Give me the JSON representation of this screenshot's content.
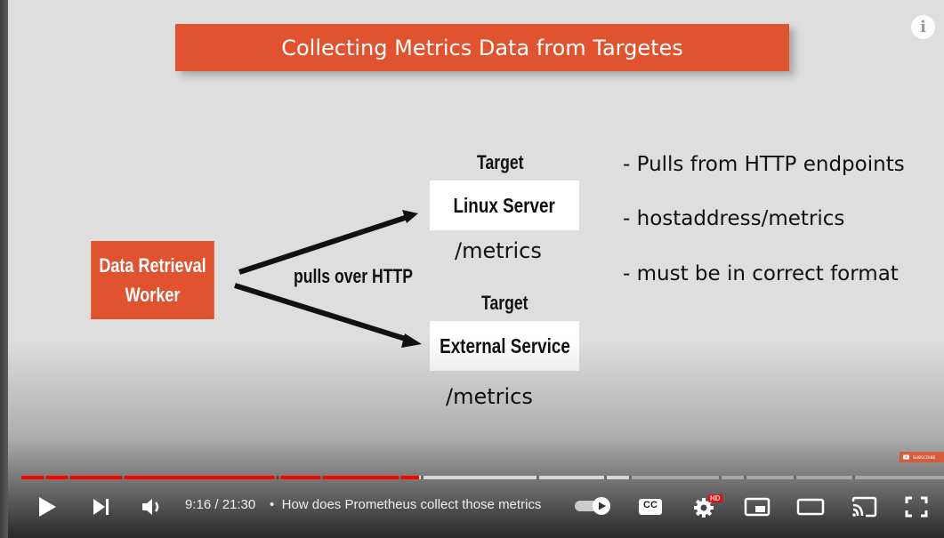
{
  "slide": {
    "title": "Collecting Metrics Data from Targetes",
    "worker": {
      "line1": "Data Retrieval",
      "line2": "Worker"
    },
    "pulls_label": "pulls over HTTP",
    "target_label": "Target",
    "target1": {
      "name": "Linux Server",
      "path": "/metrics"
    },
    "target2": {
      "name": "External Service",
      "path": "/metrics"
    },
    "bullets": [
      "- Pulls from HTTP endpoints",
      "- hostaddress/metrics",
      "- must be in correct format"
    ],
    "colors": {
      "accent": "#e1522e",
      "background": "#dedede"
    }
  },
  "player": {
    "time": "9:16 / 21:30",
    "separator": "•",
    "chapter_title": "How does Prometheus collect those metrics",
    "hd_badge": "HD",
    "cc_label": "CC",
    "watermark": "SUBSCRIBE",
    "progress_played": 0.431,
    "progress_buffered": 0.66,
    "colors": {
      "played": "#ff0000"
    },
    "icons": [
      "play-icon",
      "next-icon",
      "volume-icon",
      "autoplay-toggle-icon",
      "subtitles-icon",
      "settings-icon",
      "miniplayer-icon",
      "theater-icon",
      "cast-icon",
      "fullscreen-icon"
    ]
  }
}
